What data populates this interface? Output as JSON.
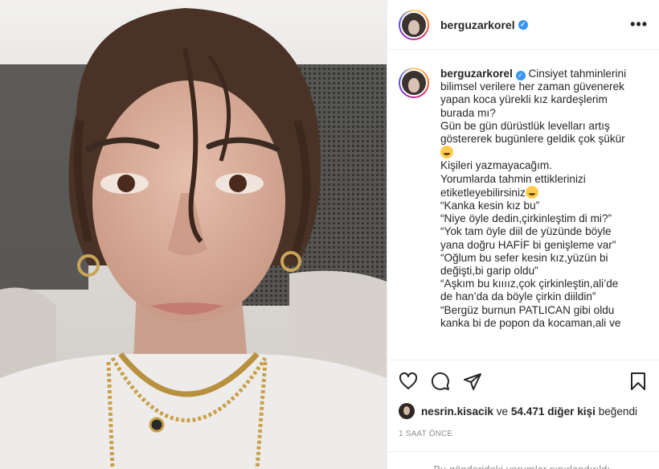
{
  "post": {
    "username": "berguzarkorel",
    "verified_icon": "verified-badge-icon",
    "more_label": "•••",
    "caption_lines": [
      "Cinsiyet tahminlerini",
      "bilimsel verilere her zaman güvenerek",
      "yapan koca yürekli kız kardeşlerim",
      "burada mı?",
      "Gün be gün dürüstlük levelları artış",
      "göstererek bugünlere geldik çok şükür",
      "",
      "Kişileri yazmayacağım.",
      "Yorumlarda tahmin ettiklerinizi",
      "etiketleyebilirsiniz",
      "“Kanka kesin kız bu”",
      "“Niye öyle dedin,çirkinleştim di mi?”",
      "“Yok tam öyle diil de yüzünde böyle",
      "yana doğru HAFİF bi genişleme var”",
      "“Oğlum bu sefer kesin kız,yüzün bi",
      "değişti,bi garip oldu”",
      "“Aşkım bu kıııız,çok çirkinleştin,ali’de",
      "de han’da da böyle çirkin diildin”",
      "“Bergüz burnun PATLICAN gibi oldu",
      "kanka bi de popon da kocaman,ali ve"
    ],
    "emoji_icons": [
      "laughing-emoji-icon",
      "winking-emoji-icon"
    ]
  },
  "actions": {
    "like_icon": "heart-icon",
    "comment_icon": "comment-icon",
    "share_icon": "share-icon",
    "save_icon": "bookmark-icon"
  },
  "likes": {
    "liker": "nesrin.kisacik",
    "connector": "ve",
    "count": "54.471 diğer kişi",
    "suffix": "beğendi"
  },
  "timestamp": "1 SAAT ÖNCE",
  "comments_notice": "Bu gönderideki yorumlar sınırlandırıldı.",
  "colors": {
    "verified": "#3897f0",
    "text": "#262626",
    "muted": "#8e8e8e",
    "border": "#efefef"
  }
}
